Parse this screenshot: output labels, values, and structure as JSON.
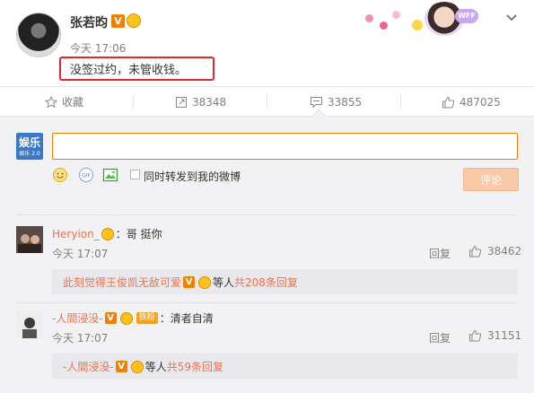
{
  "post": {
    "author": "张若昀",
    "verified_badge": "V",
    "time": "今天 17:06",
    "text": "没签过约，未管收钱。",
    "deco_badge": "WFF"
  },
  "actions": {
    "favorite": "收藏",
    "repost_count": "38348",
    "comment_count": "33855",
    "like_count": "487025"
  },
  "composer": {
    "logo_text": "娱乐",
    "logo_sub": "娱乐 2.0",
    "input_value": "",
    "repost_label": "同时转发到我的微博",
    "submit_label": "评论"
  },
  "comments": [
    {
      "user": "Heryion_",
      "separator": "：",
      "text": "哥 挺你",
      "time": "今天 17:07",
      "reply_label": "回复",
      "likes": "38462",
      "reply_preview": {
        "user": "此刻觉得王俊凯无敌可爱",
        "middle": "等人",
        "count": "共208条回复"
      }
    },
    {
      "user": "-人間浸没-",
      "fan_badge": "铁粉",
      "separator": "：",
      "text": "清者自清",
      "time": "今天 17:07",
      "reply_label": "回复",
      "likes": "31151",
      "reply_preview": {
        "user": "-人間浸没-",
        "middle": "等人",
        "count": "共59条回复"
      }
    }
  ],
  "colors": {
    "accent_orange": "#f08000",
    "username": "#eb7350",
    "highlight_box": "#e4252c",
    "panel_bg": "#f2f2f5"
  }
}
